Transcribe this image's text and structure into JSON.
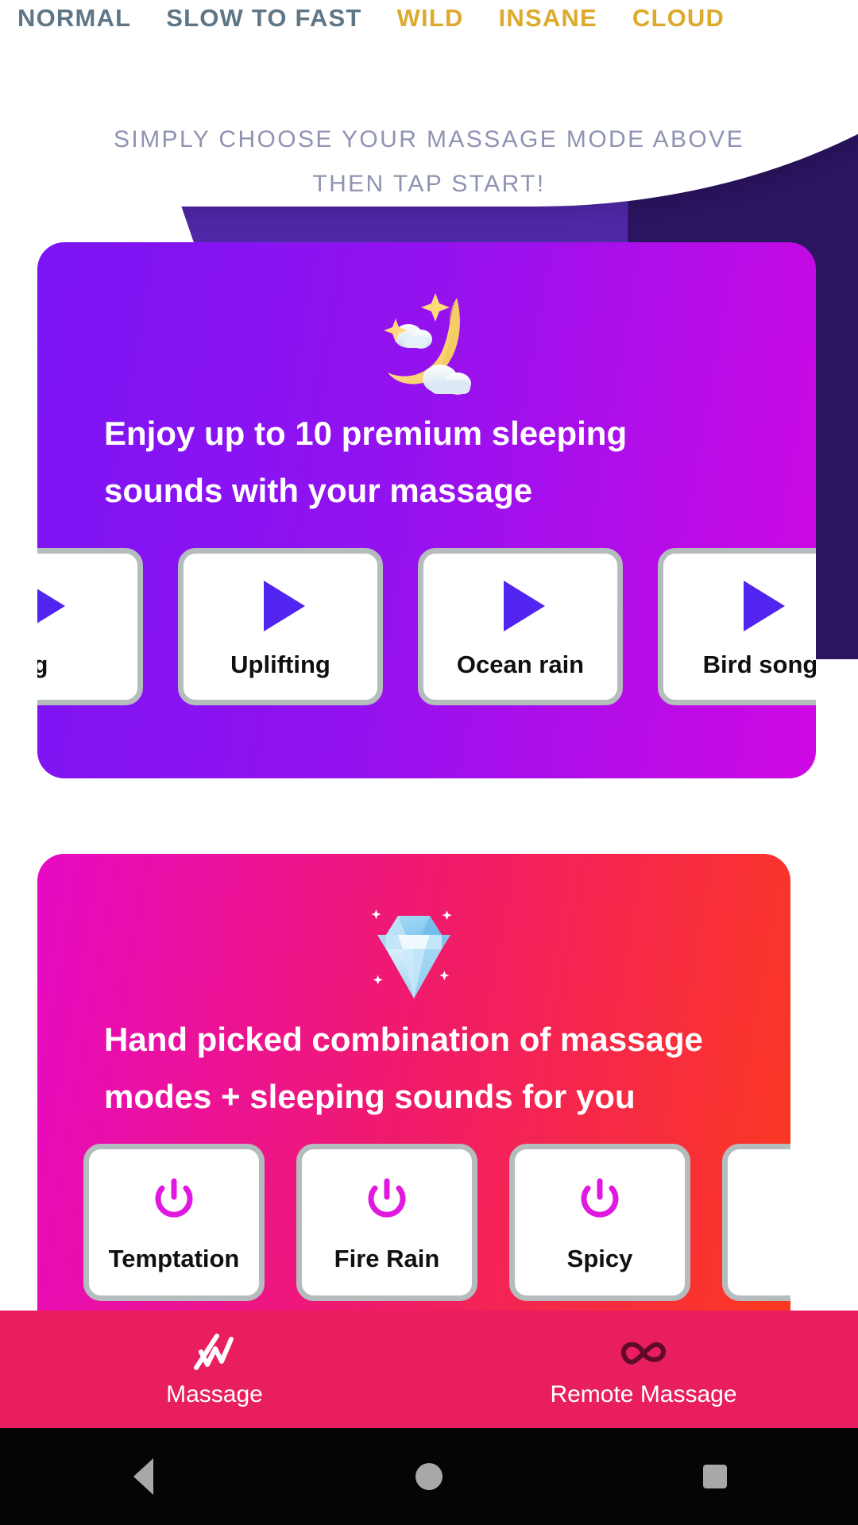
{
  "header": {
    "mode_tabs": [
      {
        "label": "NORMAL",
        "style": "inactive"
      },
      {
        "label": "SLOW TO FAST",
        "style": "inactive"
      },
      {
        "label": "WILD",
        "style": "accent"
      },
      {
        "label": "INSANE",
        "style": "accent"
      },
      {
        "label": "CLOUD",
        "style": "accent"
      }
    ],
    "subtitle_line1": "SIMPLY CHOOSE YOUR MASSAGE MODE ABOVE",
    "subtitle_line2": "THEN TAP START!",
    "accent_color": "#dcaa2d",
    "inactive_color": "#5e7685",
    "subtitle_color": "#8f93b2"
  },
  "sleep_card": {
    "icon": "crescent-moon-with-clouds-and-stars",
    "headline_line1": "Enjoy up to 10 premium sleeping",
    "headline_line2": "sounds with your massage",
    "gradient_from": "#7b14f5",
    "gradient_to": "#cf08e2",
    "tiles": [
      {
        "label": "g",
        "icon": "play-icon",
        "partial": true
      },
      {
        "label": "Uplifting",
        "icon": "play-icon",
        "partial": false
      },
      {
        "label": "Ocean rain",
        "icon": "play-icon",
        "partial": false
      },
      {
        "label": "Bird song",
        "icon": "play-icon",
        "partial": false
      }
    ],
    "play_icon_color": "#5124ef"
  },
  "premium_card": {
    "icon": "gem-diamond-sparkles",
    "headline_line1": "Hand picked combination of massage",
    "headline_line2": "modes + sleeping sounds for you",
    "gradient_from": "#e60ac4",
    "gradient_to": "#fc3a1c",
    "tiles": [
      {
        "label": "Temptation",
        "icon": "power-icon",
        "partial": false
      },
      {
        "label": "Fire Rain",
        "icon": "power-icon",
        "partial": false
      },
      {
        "label": "Spicy",
        "icon": "power-icon",
        "partial": false
      },
      {
        "label": "",
        "icon": "power-icon",
        "partial": true
      }
    ],
    "power_icon_color": "#e019e0"
  },
  "bottom_nav": {
    "background": "#e91e5f",
    "items": [
      {
        "label": "Massage",
        "icon": "waveform-zigzag-icon",
        "active": true
      },
      {
        "label": "Remote Massage",
        "icon": "infinity-icon",
        "active": false
      }
    ]
  },
  "system_bar": {
    "buttons": [
      {
        "name": "back",
        "icon": "triangle-left-icon"
      },
      {
        "name": "home",
        "icon": "circle-icon"
      },
      {
        "name": "recents",
        "icon": "square-icon"
      }
    ]
  }
}
